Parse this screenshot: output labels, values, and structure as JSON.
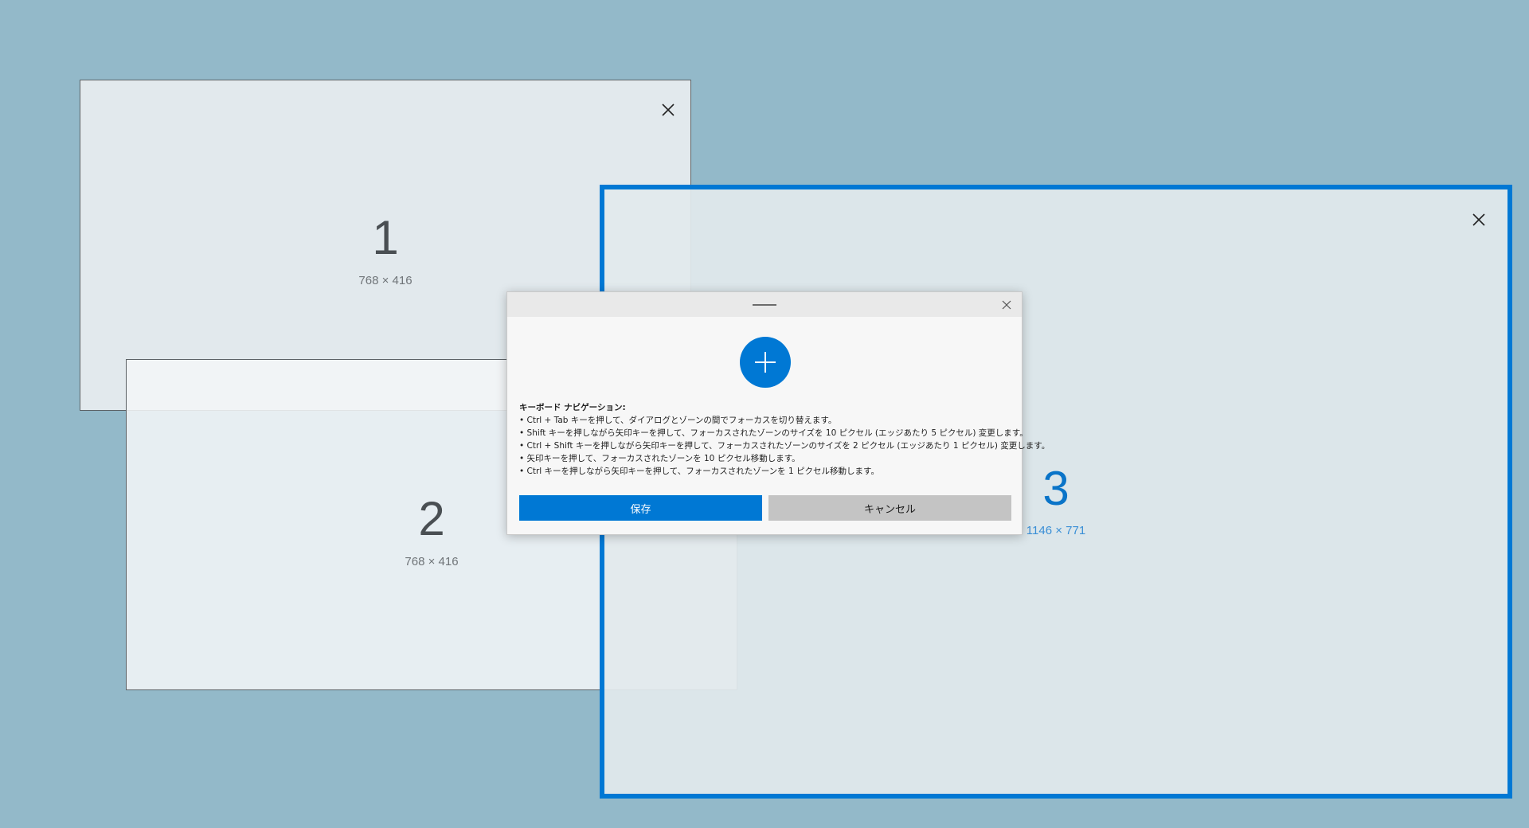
{
  "zones": [
    {
      "number": "1",
      "size": "768 × 416"
    },
    {
      "number": "2",
      "size": "768 × 416"
    },
    {
      "number": "3",
      "size": "1146 × 771"
    }
  ],
  "colors": {
    "background": "#93b9c9",
    "zone_fill": "#e2e9ed",
    "accent": "#0078d4",
    "cancel": "#c4c4c4"
  },
  "icons": {
    "zone_close": "close-icon",
    "dialog_close": "close-icon",
    "add": "plus-icon"
  },
  "dialog": {
    "help_title": "キーボード ナビゲーション:",
    "help_items": [
      "• Ctrl + Tab キーを押して、ダイアログとゾーンの間でフォーカスを切り替えます。",
      "• Shift キーを押しながら矢印キーを押して、フォーカスされたゾーンのサイズを 10 ピクセル (エッジあたり 5 ピクセル) 変更します。",
      "• Ctrl + Shift キーを押しながら矢印キーを押して、フォーカスされたゾーンのサイズを 2 ピクセル (エッジあたり 1 ピクセル) 変更します。",
      "• 矢印キーを押して、フォーカスされたゾーンを 10 ピクセル移動します。",
      "• Ctrl キーを押しながら矢印キーを押して、フォーカスされたゾーンを 1 ピクセル移動します。"
    ],
    "save_label": "保存",
    "cancel_label": "キャンセル"
  }
}
